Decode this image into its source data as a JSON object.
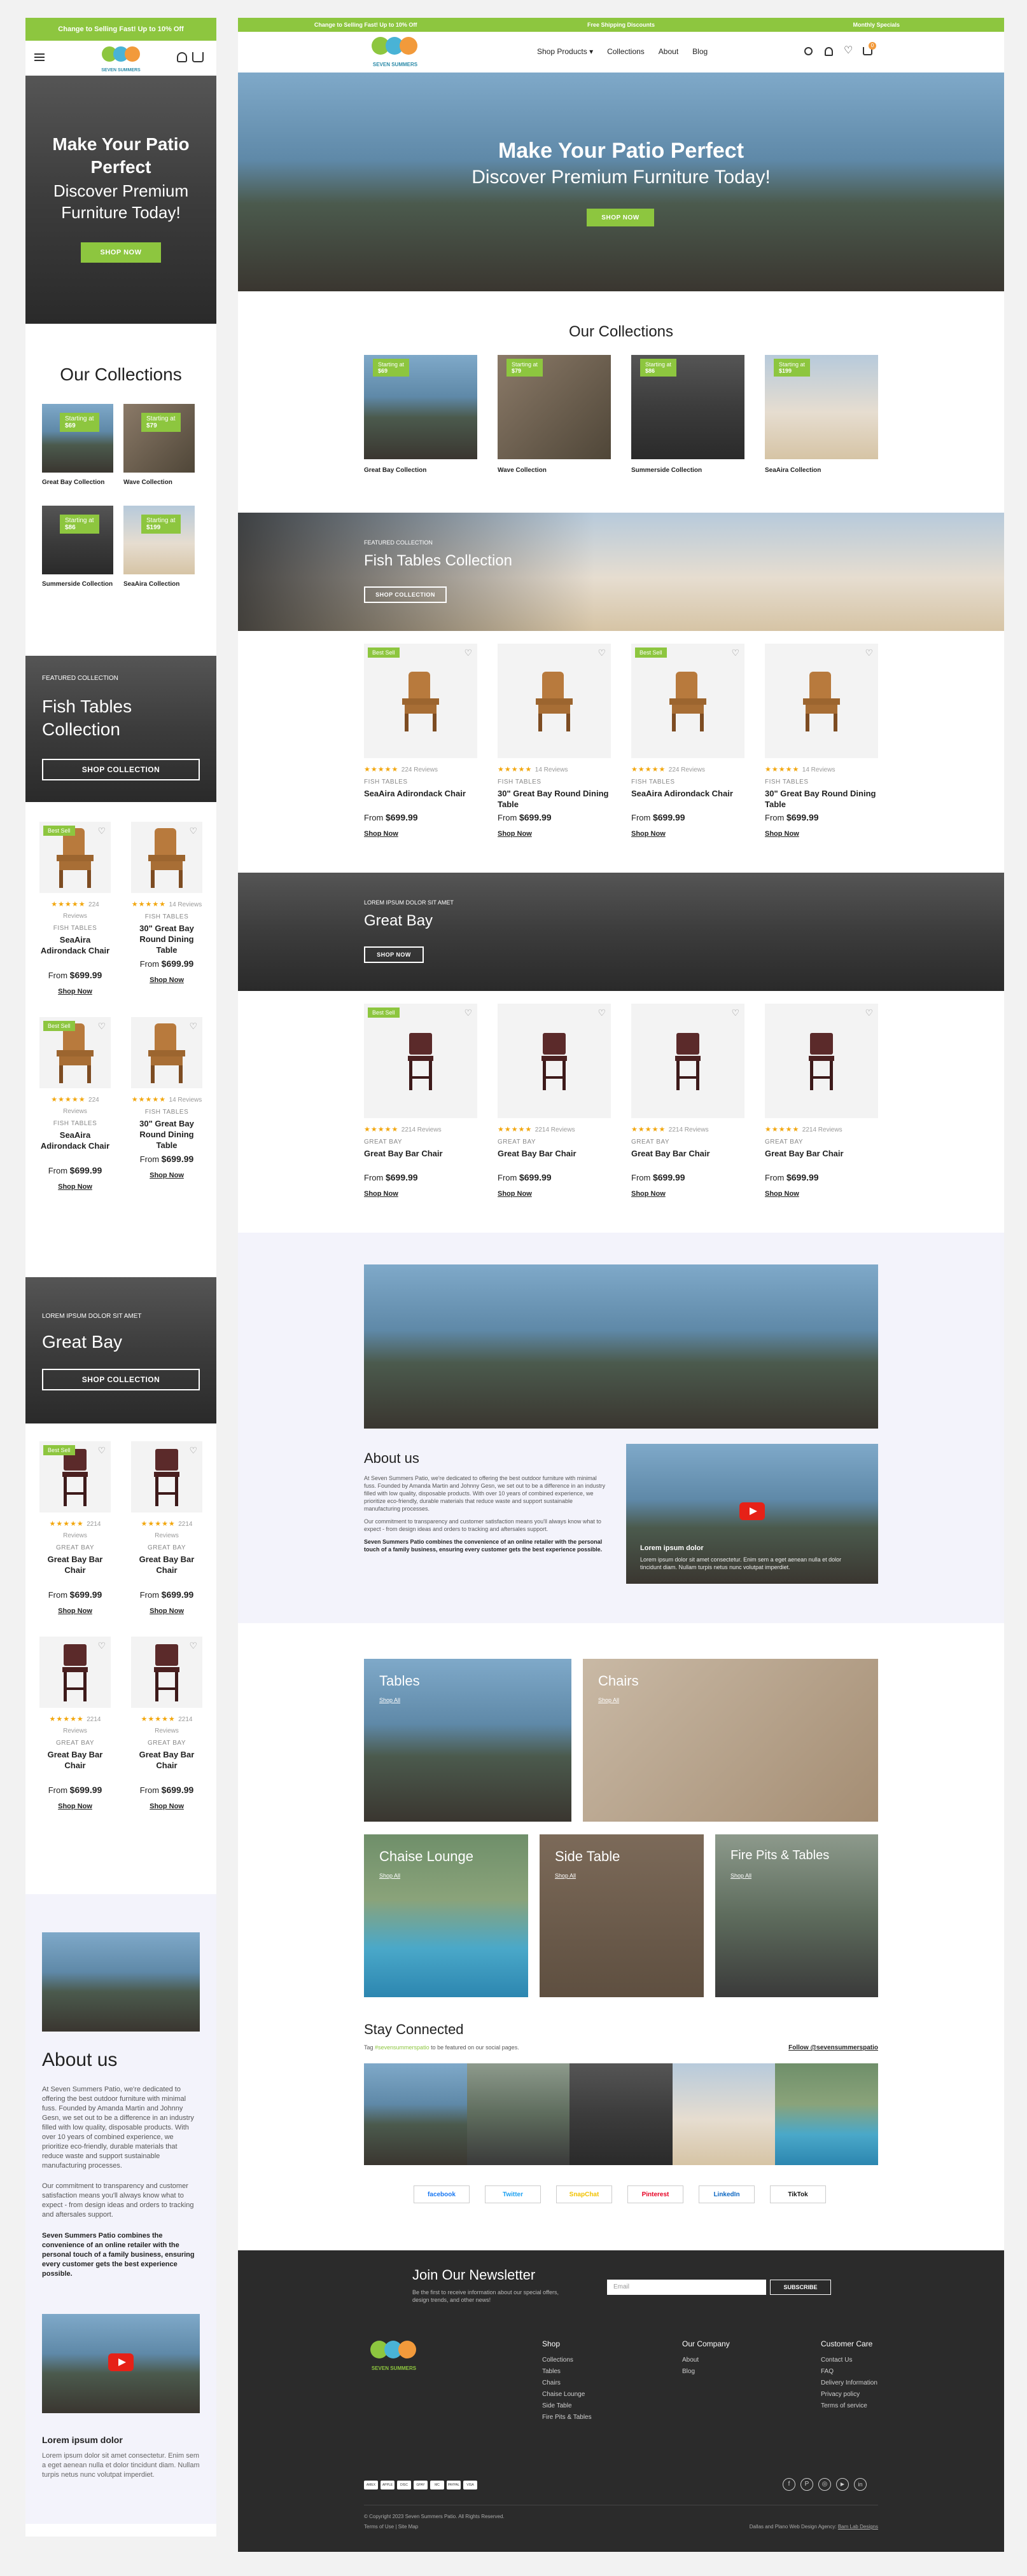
{
  "announcement": {
    "promo": "Change to Selling Fast! Up to 10% Off",
    "shipping": "Free Shipping Discounts",
    "monthly": "Monthly Specials"
  },
  "brand": {
    "name": "SEVEN SUMMERS",
    "tagline": "PATIO"
  },
  "nav": {
    "products": "Shop Products",
    "collections": "Collections",
    "about": "About",
    "blog": "Blog",
    "cart_count": "0"
  },
  "hero": {
    "line1": "Make Your Patio Perfect",
    "line2": "Discover Premium Furniture Today!",
    "cta": "SHOP NOW"
  },
  "collections": {
    "heading": "Our Collections",
    "starting_label": "Starting at",
    "items": [
      {
        "name": "Great Bay Collection",
        "price": "$69"
      },
      {
        "name": "Wave Collection",
        "price": "$79"
      },
      {
        "name": "Summerside Collection",
        "price": "$86"
      },
      {
        "name": "SeaAira Collection",
        "price": "$199"
      }
    ]
  },
  "featured": {
    "eyebrow": "FEATURED COLLECTION",
    "title": "Fish Tables Collection",
    "cta": "SHOP COLLECTION"
  },
  "fish_products": [
    {
      "badge": "Best Sell",
      "reviews": "224 Reviews",
      "category": "FISH TABLES",
      "name": "SeaAira Adirondack Chair",
      "from": "From",
      "price": "$699.99",
      "shop": "Shop Now"
    },
    {
      "badge": "",
      "reviews": "14 Reviews",
      "category": "FISH TABLES",
      "name": "30\" Great Bay Round Dining Table",
      "from": "From",
      "price": "$699.99",
      "shop": "Shop Now"
    },
    {
      "badge": "Best Sell",
      "reviews": "224 Reviews",
      "category": "FISH TABLES",
      "name": "SeaAira Adirondack Chair",
      "from": "From",
      "price": "$699.99",
      "shop": "Shop Now"
    },
    {
      "badge": "",
      "reviews": "14 Reviews",
      "category": "FISH TABLES",
      "name": "30\" Great Bay Round Dining Table",
      "from": "From",
      "price": "$699.99",
      "shop": "Shop Now"
    }
  ],
  "greatbay": {
    "eyebrow": "LOREM IPSUM DOLOR SIT AMET",
    "title": "Great Bay",
    "cta": "SHOP NOW",
    "mobile_cta": "SHOP COLLECTION"
  },
  "bay_products": [
    {
      "badge": "Best Sell",
      "reviews": "2214 Reviews",
      "category": "GREAT BAY",
      "name": "Great Bay Bar Chair",
      "from": "From",
      "price": "$699.99",
      "shop": "Shop Now"
    },
    {
      "badge": "",
      "reviews": "2214 Reviews",
      "category": "GREAT BAY",
      "name": "Great Bay Bar Chair",
      "from": "From",
      "price": "$699.99",
      "shop": "Shop Now"
    },
    {
      "badge": "",
      "reviews": "2214 Reviews",
      "category": "GREAT BAY",
      "name": "Great Bay Bar Chair",
      "from": "From",
      "price": "$699.99",
      "shop": "Shop Now"
    },
    {
      "badge": "",
      "reviews": "2214 Reviews",
      "category": "GREAT BAY",
      "name": "Great Bay Bar Chair",
      "from": "From",
      "price": "$699.99",
      "shop": "Shop Now"
    }
  ],
  "about": {
    "heading": "About us",
    "p1": "At Seven Summers Patio, we're dedicated to offering the best outdoor furniture with minimal fuss. Founded by Amanda Martin and Johnny Gesn, we set out to be a difference in an industry filled with low quality, disposable products. With over 10 years of combined experience, we prioritize eco-friendly, durable materials that reduce waste and support sustainable manufacturing processes.",
    "p2": "Our commitment to transparency and customer satisfaction means you'll always know what to expect - from design ideas and orders to tracking and aftersales support.",
    "p3": "Seven Summers Patio combines the convenience of an online retailer with the personal touch of a family business, ensuring every customer gets the best experience possible.",
    "video_title": "Lorem ipsum dolor",
    "video_text": "Lorem ipsum dolor sit amet consectetur. Enim sem a eget aenean nulla et dolor tincidunt diam. Nullam turpis netus nunc volutpat imperdiet."
  },
  "categories": {
    "shop_all": "Shop All",
    "items": [
      "Tables",
      "Chairs",
      "Chaise Lounge",
      "Side Table",
      "Fire Pits & Tables"
    ]
  },
  "social": {
    "heading": "Stay Connected",
    "tag_prefix": "Tag",
    "handle": "#sevensummerspatio",
    "tag_suffix": "to be featured on our social pages.",
    "follow": "Follow @sevensummerspatio",
    "buttons": [
      "facebook",
      "Twitter",
      "SnapChat",
      "Pinterest",
      "LinkedIn",
      "TikTok"
    ]
  },
  "newsletter": {
    "heading": "Join Our Newsletter",
    "sub": "Be the first to receive information about our special offers, design trends, and other news!",
    "placeholder": "Email",
    "cta": "SUBSCRIBE"
  },
  "footer": {
    "shop_h": "Shop",
    "shop": [
      "Collections",
      "Tables",
      "Chairs",
      "Chaise Lounge",
      "Side Table",
      "Fire Pits & Tables"
    ],
    "company_h": "Our Company",
    "company": [
      "About",
      "Blog"
    ],
    "care_h": "Customer Care",
    "care": [
      "Contact Us",
      "FAQ",
      "Delivery Information",
      "Privacy policy",
      "Terms of service"
    ],
    "payments": [
      "AMEX",
      "APPLE",
      "DISC",
      "GPAY",
      "MC",
      "PAYPAL",
      "VISA"
    ],
    "copyright": "© Copyright 2023 Seven Summers Patio. All Rights Reserved.",
    "terms": "Terms of Use",
    "sitemap": "Site Map",
    "credit_prefix": "Dallas and Plano Web Design Agency:",
    "credit": "Bam Lab Designs"
  }
}
